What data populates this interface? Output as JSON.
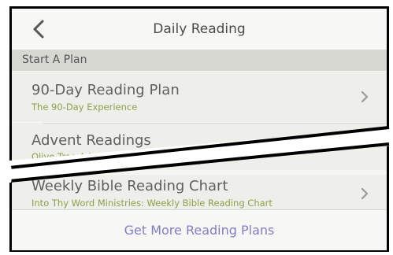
{
  "header": {
    "title": "Daily Reading",
    "back_icon": "chevron-left-icon"
  },
  "section": {
    "label": "Start A Plan"
  },
  "plans": [
    {
      "title": "90-Day Reading Plan",
      "subtitle": "The 90-Day Experience"
    },
    {
      "title": "Advent Readings",
      "subtitle": "Olive Tree Advent Re"
    },
    {
      "title": "Weekly Bible Reading Chart",
      "subtitle": "Into Thy Word Ministries: Weekly Bible Reading Chart"
    }
  ],
  "footer": {
    "link_label": "Get More Reading Plans"
  },
  "colors": {
    "subtitle": "#8aa24a",
    "link": "#7f7fc6",
    "section_bg": "#d8d8d3"
  }
}
